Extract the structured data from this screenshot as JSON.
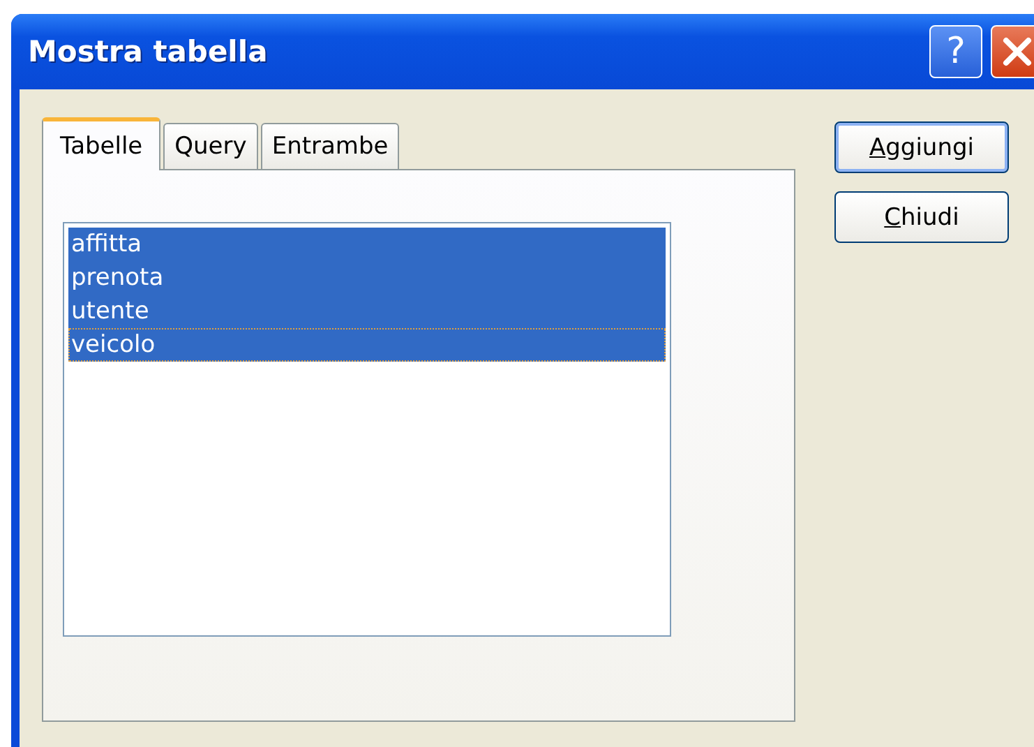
{
  "window": {
    "title": "Mostra tabella",
    "help_button": "?"
  },
  "tabs": [
    {
      "label": "Tabelle",
      "selected": true
    },
    {
      "label": "Query",
      "selected": false
    },
    {
      "label": "Entrambe",
      "selected": false
    }
  ],
  "list": [
    {
      "label": "affitta",
      "selected": true,
      "focused": false
    },
    {
      "label": "prenota",
      "selected": true,
      "focused": false
    },
    {
      "label": "utente",
      "selected": true,
      "focused": false
    },
    {
      "label": "veicolo",
      "selected": true,
      "focused": true
    }
  ],
  "buttons": [
    {
      "label": "Aggiungi",
      "default": true
    },
    {
      "label": "Chiudi",
      "default": false
    }
  ]
}
